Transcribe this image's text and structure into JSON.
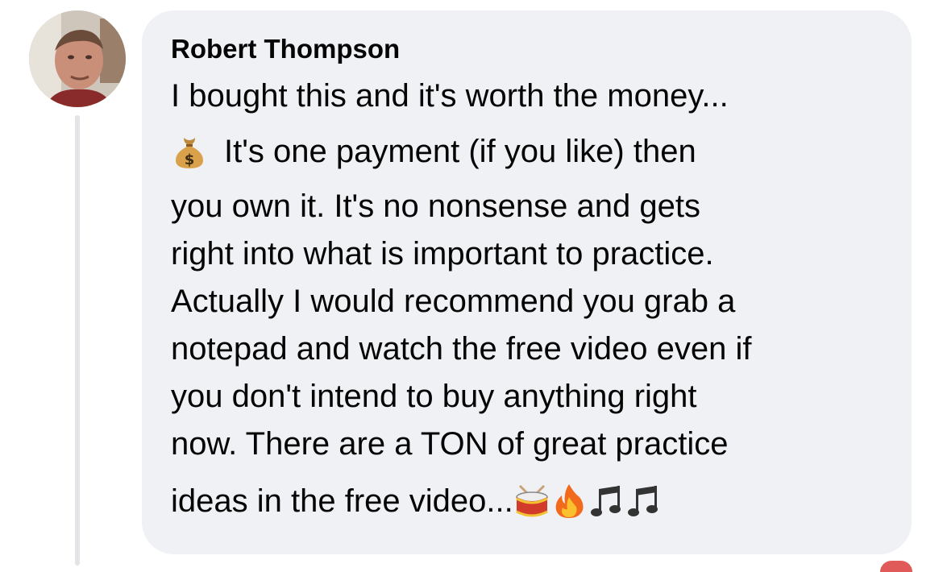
{
  "comment": {
    "author": "Robert Thompson",
    "avatar_icon": "profile-photo",
    "text_lines": [
      "I bought this and it's worth the money...",
      "It's one payment (if you like) then",
      "you own it. It's no nonsense and gets",
      "right into what is important to practice.",
      "Actually I would recommend you grab a",
      "notepad and watch the free video even if",
      "you don't intend to buy anything right",
      "now. There are a TON of great practice",
      "ideas in the free video..."
    ],
    "inline_emoji": "money-bag-icon",
    "trailing_emojis": [
      "drum-icon",
      "fire-icon",
      "music-notes-icon",
      "music-notes-icon"
    ]
  },
  "colors": {
    "bubble_background": "#f0f1f5",
    "text": "#050505",
    "thread_line": "#e3e4e8"
  }
}
